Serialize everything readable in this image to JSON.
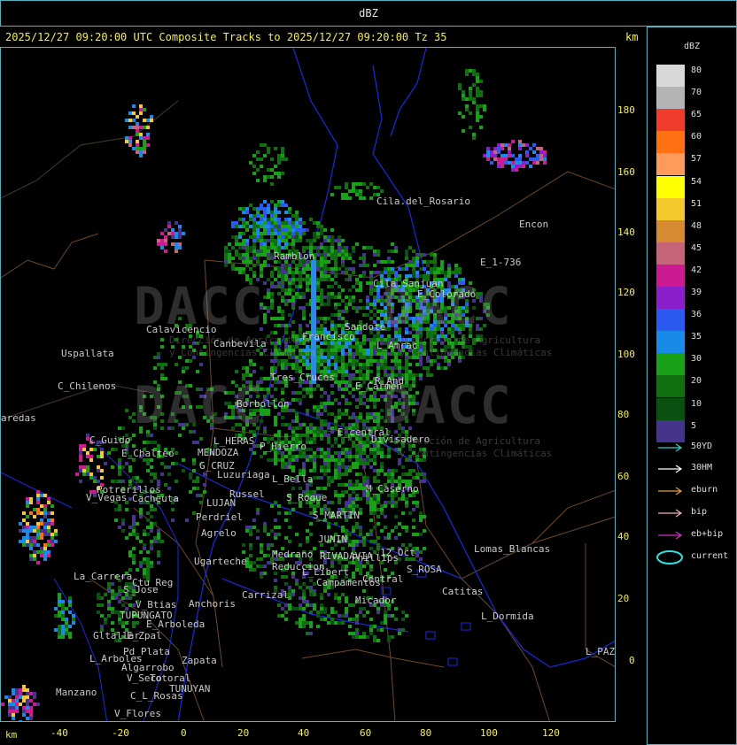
{
  "window": {
    "title": "dBZ"
  },
  "header": {
    "text": "2025/12/27 09:20:00 UTC Composite Tracks to 2025/12/27 09:20:00 Tz 35",
    "km_label": "km"
  },
  "axes": {
    "x_unit": "km",
    "x_ticks": [
      "-40",
      "-20",
      "0",
      "20",
      "40",
      "60",
      "80",
      "100",
      "120"
    ],
    "y_ticks": [
      "180",
      "160",
      "140",
      "120",
      "100",
      "80",
      "60",
      "40",
      "20",
      "0"
    ]
  },
  "legend": {
    "title": "dBZ",
    "scale": [
      {
        "value": "80",
        "color": "#d8d8d8"
      },
      {
        "value": "70",
        "color": "#b4b4b4"
      },
      {
        "value": "65",
        "color": "#f03c2a"
      },
      {
        "value": "60",
        "color": "#ff7012"
      },
      {
        "value": "57",
        "color": "#ff9a5a"
      },
      {
        "value": "54",
        "color": "#ffff00"
      },
      {
        "value": "51",
        "color": "#f5c92e"
      },
      {
        "value": "48",
        "color": "#d68a32"
      },
      {
        "value": "45",
        "color": "#c46478"
      },
      {
        "value": "42",
        "color": "#cc1a92"
      },
      {
        "value": "39",
        "color": "#8a1ec8"
      },
      {
        "value": "36",
        "color": "#2a5af0"
      },
      {
        "value": "35",
        "color": "#1a8ae8"
      },
      {
        "value": "30",
        "color": "#18a018"
      },
      {
        "value": "20",
        "color": "#107010"
      },
      {
        "value": "10",
        "color": "#0a5010"
      },
      {
        "value": "5",
        "color": "#46348c"
      }
    ],
    "tracks": [
      {
        "label": "50YD",
        "color": "#30d0d0"
      },
      {
        "label": "30HM",
        "color": "#ffffff"
      },
      {
        "label": "eburn",
        "color": "#e0a040"
      },
      {
        "label": "bip",
        "color": "#f0b0c0"
      },
      {
        "label": "eb+bip",
        "color": "#d030c0"
      },
      {
        "label": "current",
        "color": "#30e0e0"
      }
    ]
  },
  "watermark": {
    "brand": "DACC",
    "subtitle1": "Dirección de Agricultura",
    "subtitle2": "y Contingencias Climáticas"
  },
  "places": [
    {
      "name": "Cila.del_Rosario"
    },
    {
      "name": "Encon"
    },
    {
      "name": "E_1-736"
    },
    {
      "name": "Ramblon"
    },
    {
      "name": "Cila.Sanjuan"
    },
    {
      "name": "E_Colorado"
    },
    {
      "name": "Calavicencio"
    },
    {
      "name": "Uspallata"
    },
    {
      "name": "Canbevila"
    },
    {
      "name": "Francisco"
    },
    {
      "name": "Sandote"
    },
    {
      "name": "L_Amrac"
    },
    {
      "name": "C_Chilenos"
    },
    {
      "name": "Tres_Cruces"
    },
    {
      "name": "E_Carmen"
    },
    {
      "name": "R_And"
    },
    {
      "name": "Borbollon"
    },
    {
      "name": "E_central"
    },
    {
      "name": "Divisadero"
    },
    {
      "name": "C_Guido"
    },
    {
      "name": "L_HERAS"
    },
    {
      "name": "P_Hierro"
    },
    {
      "name": "MENDOZA"
    },
    {
      "name": "E_Chalteo"
    },
    {
      "name": "G_CRUZ"
    },
    {
      "name": "Luzuriaga"
    },
    {
      "name": "L_Bella"
    },
    {
      "name": "Potrerillos"
    },
    {
      "name": "V_Vegas"
    },
    {
      "name": "Cacheuta"
    },
    {
      "name": "Russel"
    },
    {
      "name": "S_Roque"
    },
    {
      "name": "M_Caserno"
    },
    {
      "name": "Perdriel"
    },
    {
      "name": "LUJAN"
    },
    {
      "name": "Agrelo"
    },
    {
      "name": "S_MARTIN"
    },
    {
      "name": "JUNIN"
    },
    {
      "name": "Ugarteche"
    },
    {
      "name": "Medrano"
    },
    {
      "name": "Reduccion"
    },
    {
      "name": "RIVADAVIA"
    },
    {
      "name": "Phillips"
    },
    {
      "name": "12_Oct"
    },
    {
      "name": "S_ROSA"
    },
    {
      "name": "Lomas_Blancas"
    },
    {
      "name": "La_Carrera"
    },
    {
      "name": "S_Jose"
    },
    {
      "name": "Ctu_Reg"
    },
    {
      "name": "V_Btias"
    },
    {
      "name": "TUPUNGATO"
    },
    {
      "name": "Anchoris"
    },
    {
      "name": "Carrizal"
    },
    {
      "name": "L_Libert"
    },
    {
      "name": "Campamentos"
    },
    {
      "name": "Central"
    },
    {
      "name": "Catitas"
    },
    {
      "name": "E_Arboleda"
    },
    {
      "name": "Micador"
    },
    {
      "name": "L_Dormida"
    },
    {
      "name": "Gltallar"
    },
    {
      "name": "E_Zpal"
    },
    {
      "name": "L_Arboles"
    },
    {
      "name": "Pd_Plata"
    },
    {
      "name": "Zapata"
    },
    {
      "name": "Algarrobo"
    },
    {
      "name": "V_Seco"
    },
    {
      "name": "Totoral"
    },
    {
      "name": "TUNUYAN"
    },
    {
      "name": "Manzano"
    },
    {
      "name": "C_L_Rosas"
    },
    {
      "name": "V_Flores"
    },
    {
      "name": "L_PAZ"
    },
    {
      "name": "aredas"
    }
  ]
}
